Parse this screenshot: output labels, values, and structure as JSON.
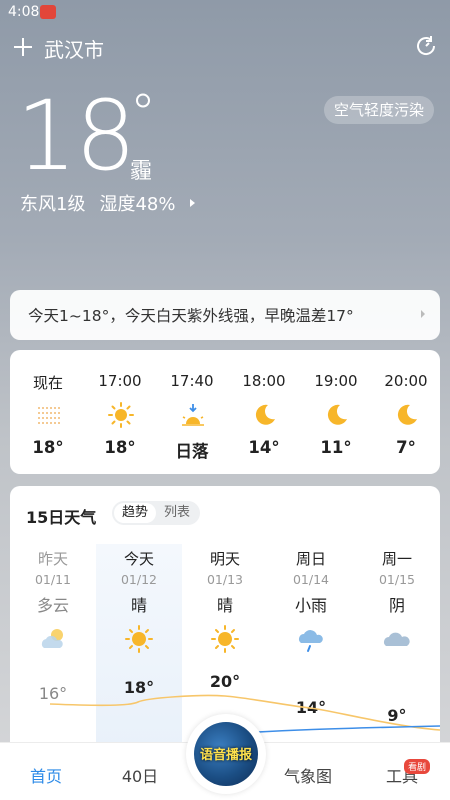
{
  "status_bar": {
    "time": "4:08"
  },
  "header": {
    "city": "武汉市"
  },
  "current": {
    "temperature": "18",
    "degree": "°",
    "condition": "霾",
    "aqi_label": "空气轻度污染",
    "wind": "东风1级",
    "humidity": "湿度48%"
  },
  "summary": {
    "text": "今天1~18°，今天白天紫外线强，早晚温差17°"
  },
  "hourly": [
    {
      "time": "现在",
      "icon": "haze-icon",
      "temp": "18°"
    },
    {
      "time": "17:00",
      "icon": "sun-icon",
      "temp": "18°"
    },
    {
      "time": "17:40",
      "icon": "sunset-icon",
      "temp": "日落"
    },
    {
      "time": "18:00",
      "icon": "moon-icon",
      "temp": "14°"
    },
    {
      "time": "19:00",
      "icon": "moon-icon",
      "temp": "11°"
    },
    {
      "time": "20:00",
      "icon": "moon-icon",
      "temp": "7°"
    }
  ],
  "daily": {
    "title": "15日天气",
    "toggle": {
      "trend": "趋势",
      "list": "列表"
    },
    "days": [
      {
        "name": "昨天",
        "date": "01/11",
        "cond": "多云",
        "icon": "partly-cloudy-icon",
        "high": "16°"
      },
      {
        "name": "今天",
        "date": "01/12",
        "cond": "晴",
        "icon": "sun-icon",
        "high": "18°"
      },
      {
        "name": "明天",
        "date": "01/13",
        "cond": "晴",
        "icon": "sun-icon",
        "high": "20°"
      },
      {
        "name": "周日",
        "date": "01/14",
        "cond": "小雨",
        "icon": "rain-icon",
        "high": "14°"
      },
      {
        "name": "周一",
        "date": "01/15",
        "cond": "阴",
        "icon": "cloud-icon",
        "high": "9°"
      }
    ]
  },
  "nav": {
    "home": "首页",
    "forty_day": "40日",
    "voice": "语音播报",
    "radar": "气象图",
    "tools": "工具",
    "tools_badge": "看剧"
  },
  "colors": {
    "accent": "#2e8be8",
    "sun": "#f7b62a",
    "trend_line": "#f7c66a"
  }
}
